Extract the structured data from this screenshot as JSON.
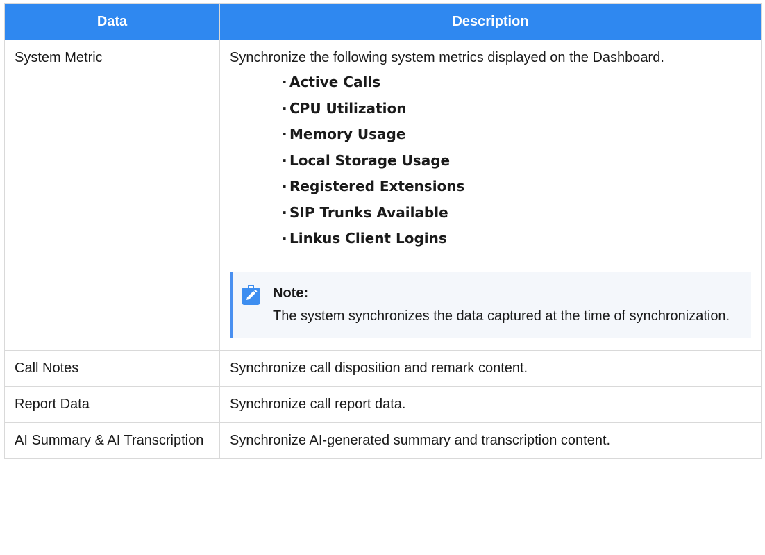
{
  "table": {
    "headers": {
      "data": "Data",
      "description": "Description"
    },
    "rows": [
      {
        "data": "System Metric",
        "description": "Synchronize the following system metrics displayed on the Dashboard.",
        "metrics": [
          "Active Calls",
          "CPU Utilization",
          "Memory Usage",
          "Local Storage Usage",
          "Registered Extensions",
          "SIP Trunks Available",
          "Linkus Client Logins"
        ],
        "note": {
          "icon": "pencil-note-icon",
          "title": "Note:",
          "text": "The system synchronizes the data captured at the time of synchronization."
        }
      },
      {
        "data": "Call Notes",
        "description": "Synchronize call disposition and remark content."
      },
      {
        "data": "Report Data",
        "description": "Synchronize call report data."
      },
      {
        "data": "AI Summary & AI Transcription",
        "description": "Synchronize AI-generated summary and transcription content."
      }
    ]
  },
  "colors": {
    "header_bg": "#2f88f0",
    "note_bar": "#4a90f0",
    "note_bg": "#f4f7fb",
    "border": "#d9d9d9"
  }
}
